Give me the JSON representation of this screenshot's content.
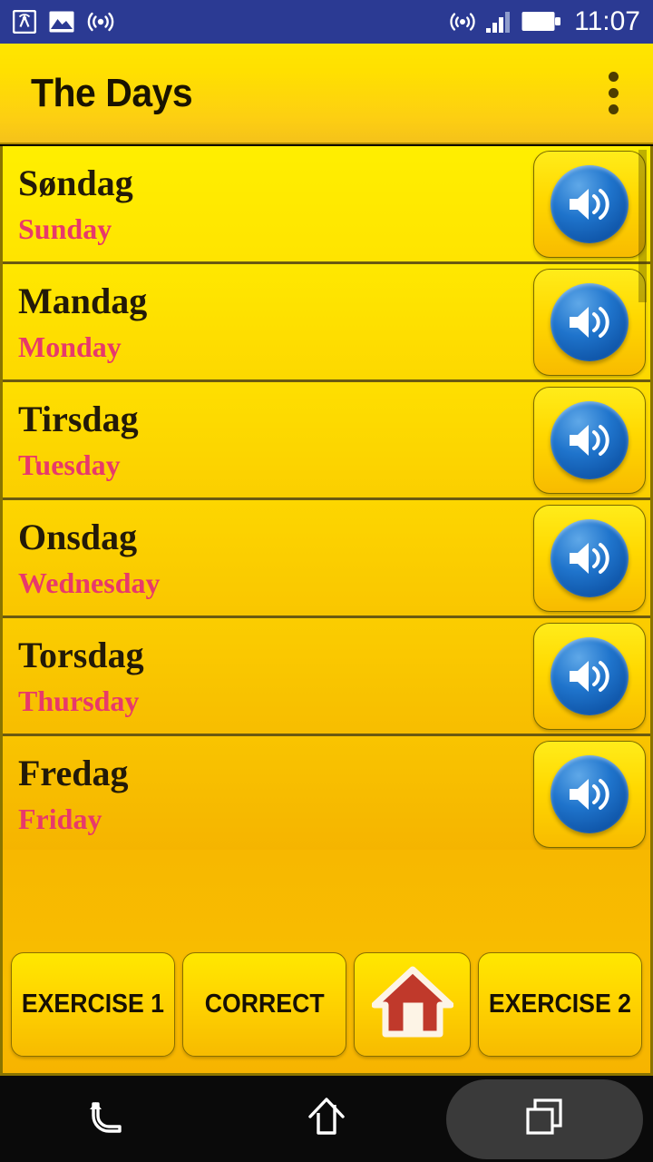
{
  "status_bar": {
    "background_color": "#2b3a93",
    "time": "11:07",
    "left_icons": [
      {
        "name": "radio-tower-icon"
      },
      {
        "name": "gallery-image-icon"
      },
      {
        "name": "wireless-signal-icon"
      }
    ],
    "right_icons": [
      {
        "name": "hotspot-icon"
      },
      {
        "name": "cellular-signal-icon"
      },
      {
        "name": "battery-icon"
      }
    ]
  },
  "toolbar": {
    "title": "The Days",
    "overflow_label": "More options",
    "accent_color": "#ffe000"
  },
  "list": {
    "scroll_position": "top",
    "items": [
      {
        "native": "Søndag",
        "translation": "Sunday",
        "speaker_label": "Play Søndag"
      },
      {
        "native": "Mandag",
        "translation": "Monday",
        "speaker_label": "Play Mandag"
      },
      {
        "native": "Tirsdag",
        "translation": "Tuesday",
        "speaker_label": "Play Tirsdag"
      },
      {
        "native": "Onsdag",
        "translation": "Wednesday",
        "speaker_label": "Play Onsdag"
      },
      {
        "native": "Torsdag",
        "translation": "Thursday",
        "speaker_label": "Play Torsdag"
      },
      {
        "native": "Fredag",
        "translation": "Friday",
        "speaker_label": "Play Fredag"
      }
    ],
    "native_text_color": "#231a08",
    "translation_text_color": "#e8396b"
  },
  "bottom_bar": {
    "buttons": [
      {
        "label": "EXERCISE 1",
        "name": "exercise-1-button"
      },
      {
        "label": "CORRECT",
        "name": "correct-button"
      },
      {
        "label": "",
        "name": "home-button",
        "icon": "house-icon"
      },
      {
        "label": "EXERCISE 2",
        "name": "exercise-2-button"
      }
    ]
  },
  "nav_bar": {
    "background_color": "#0a0a0a",
    "buttons": [
      {
        "name": "back-nav-button",
        "icon": "back-arrow-icon"
      },
      {
        "name": "home-nav-button",
        "icon": "home-outline-icon"
      },
      {
        "name": "recents-nav-button",
        "icon": "recents-squares-icon",
        "highlighted": true
      }
    ]
  }
}
